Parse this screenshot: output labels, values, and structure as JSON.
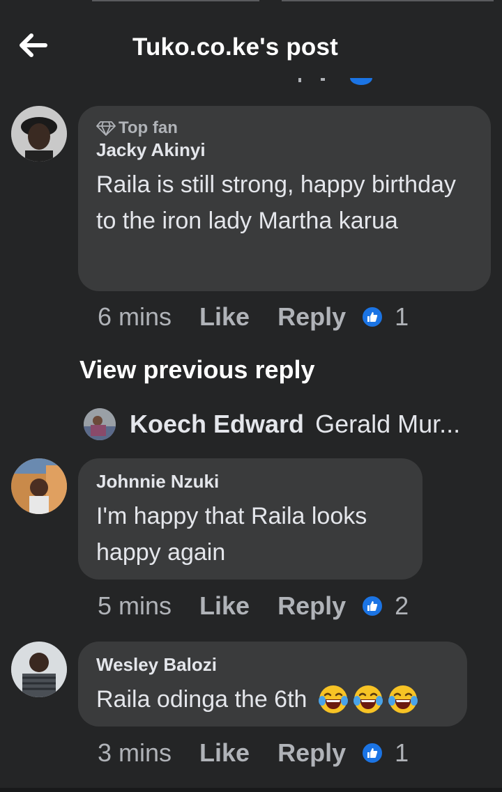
{
  "header": {
    "title": "Tuko.co.ke's post"
  },
  "comments": [
    {
      "badge": "Top fan",
      "author": "Jacky Akinyi",
      "text": "Raila is still strong, happy birthday to the iron lady Martha karua",
      "time": "6 mins",
      "like_label": "Like",
      "reply_label": "Reply",
      "reactions": "1"
    },
    {
      "author": "Johnnie Nzuki",
      "text": "I'm happy that Raila looks happy again",
      "time": "5 mins",
      "like_label": "Like",
      "reply_label": "Reply",
      "reactions": "2"
    },
    {
      "author": "Wesley Balozi",
      "text": "Raila odinga the 6th",
      "time": "3 mins",
      "like_label": "Like",
      "reply_label": "Reply",
      "reactions": "1"
    }
  ],
  "view_previous": "View previous reply",
  "reply_preview": {
    "author": "Koech Edward",
    "text": "Gerald Mur..."
  },
  "colors": {
    "background": "#242526",
    "bubble": "#3a3b3c",
    "like_blue": "#1b74e4",
    "muted_text": "#b0b3b8"
  }
}
